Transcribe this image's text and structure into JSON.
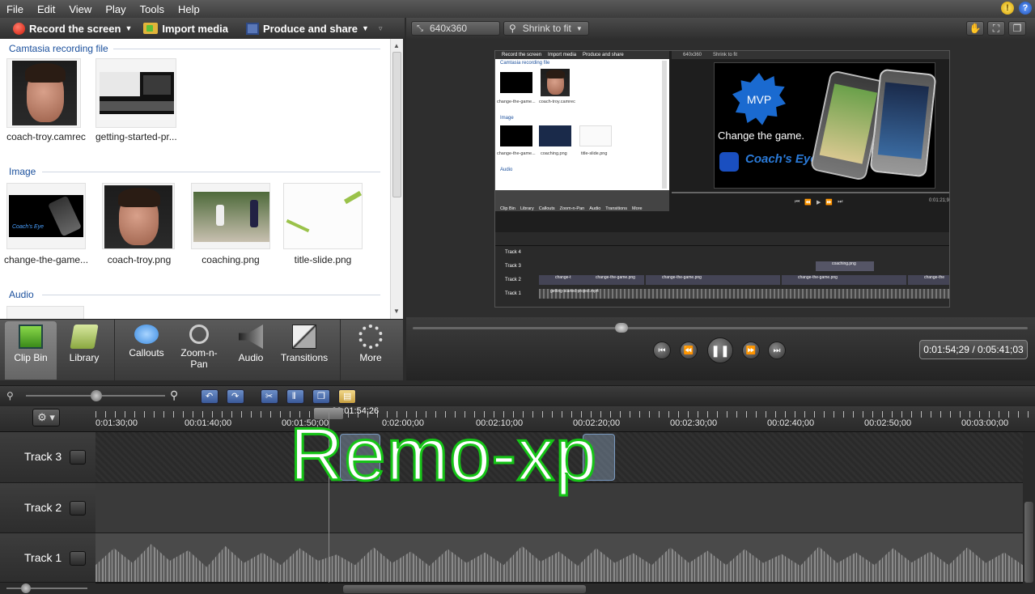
{
  "menu": [
    "File",
    "Edit",
    "View",
    "Play",
    "Tools",
    "Help"
  ],
  "toolbar": {
    "record": "Record the screen",
    "import": "Import media",
    "produce": "Produce and share"
  },
  "clipbin": {
    "sections": [
      {
        "title": "Camtasia recording file",
        "items": [
          "coach-troy.camrec",
          "getting-started-pr..."
        ]
      },
      {
        "title": "Image",
        "items": [
          "change-the-game...",
          "coach-troy.png",
          "coaching.png",
          "title-slide.png"
        ]
      },
      {
        "title": "Audio",
        "items": []
      }
    ]
  },
  "tabs": [
    "Clip Bin",
    "Library",
    "Callouts",
    "Zoom-n-Pan",
    "Audio",
    "Transitions",
    "More"
  ],
  "preview": {
    "resolution": "640x360",
    "fit": "Shrink to fit",
    "time": "0:01:54;29 / 0:05:41;03",
    "nested": {
      "record": "Record the screen",
      "import": "Import media",
      "produce": "Produce and share",
      "res": "640x360",
      "fit": "Shrink to fit",
      "section1": "Camtasia recording file",
      "section2": "Image",
      "section3": "Audio",
      "items1": [
        "change-the-game...",
        "coach-troy.camrec"
      ],
      "items2": [
        "change-the-game...",
        "coaching.png",
        "title-slide.png"
      ],
      "mvp": "MVP",
      "slogan": "Change the game.",
      "brand": "Coach's Eye",
      "tabs": [
        "Clip Bin",
        "Library",
        "Callouts",
        "Zoom-n-Pan",
        "Audio",
        "Transitions",
        "More"
      ],
      "tracks": [
        "Track 4",
        "Track 3",
        "Track 2",
        "Track 1"
      ],
      "clips": [
        "coaching.png",
        "change-t",
        "change-the-game.png",
        "change-the-game.png",
        "change-the-game.png",
        "change-the",
        "getting-started-project.mp4"
      ],
      "time": "0:01:21;9"
    }
  },
  "timeline": {
    "ruler": [
      "0:01:30;00",
      "00:01:40;00",
      "00:01:50;00",
      "00:01:54;26",
      "0:02:00;00",
      "00:02:10;00",
      "00:02:20;00",
      "00:02:30;00",
      "00:02:40;00",
      "00:02:50;00",
      "00:03:00;00"
    ],
    "tracks": [
      "Track 3",
      "Track 2",
      "Track 1"
    ]
  },
  "watermark": "Remo-xp",
  "colors": {
    "accent": "#1a4f9c",
    "watermark": "#16c417",
    "record": "#d01c0a"
  }
}
